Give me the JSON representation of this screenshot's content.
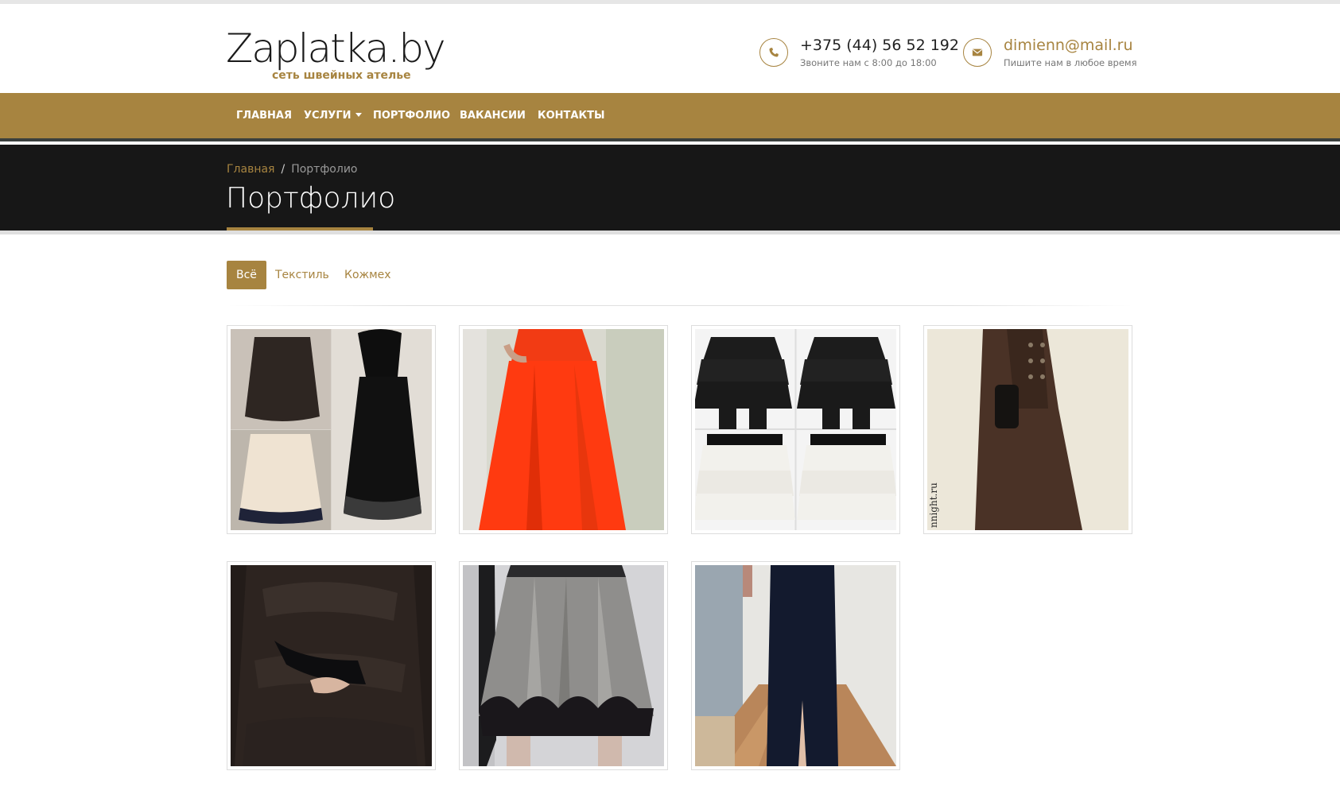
{
  "header": {
    "logo": {
      "name": "Zaplatka.by",
      "tagline": "сеть швейных ателье"
    },
    "phone": {
      "icon": "phone-icon",
      "main": "+375 (44) 56 52 192",
      "sub": "Звоните нам с 8:00 до 18:00"
    },
    "email": {
      "icon": "envelope-icon",
      "main": "dimienn@mail.ru",
      "sub": "Пишите нам в любое время"
    }
  },
  "nav": {
    "items": [
      {
        "label": "ГЛАВНАЯ"
      },
      {
        "label": "УСЛУГИ",
        "has_dropdown": true
      },
      {
        "label": "ПОРТФОЛИО"
      },
      {
        "label": "ВАКАНСИИ"
      },
      {
        "label": "КОНТАКТЫ"
      }
    ]
  },
  "breadcrumb": {
    "home": "Главная",
    "separator": "/",
    "current": "Портфолио"
  },
  "page_title": "Портфолио",
  "filters": [
    {
      "label": "Всё",
      "active": true
    },
    {
      "label": "Текстиль",
      "active": false
    },
    {
      "label": "Кожмех",
      "active": false
    }
  ],
  "portfolio": {
    "items": [
      {
        "subject": "collage of four pleated skirts in brown, black and cream"
      },
      {
        "subject": "long orange-red evening dress"
      },
      {
        "subject": "tiered ruffle skirts in black and white"
      },
      {
        "subject": "long brown coat with buttons",
        "watermark": "nnight.ru"
      },
      {
        "subject": "dark fur vest"
      },
      {
        "subject": "grey tweed skirt with black scalloped hem"
      },
      {
        "subject": "long navy dress with slit"
      }
    ]
  },
  "colors": {
    "accent": "#a78440",
    "title_band": "#171717",
    "nav_border": "#3a3f3d"
  }
}
